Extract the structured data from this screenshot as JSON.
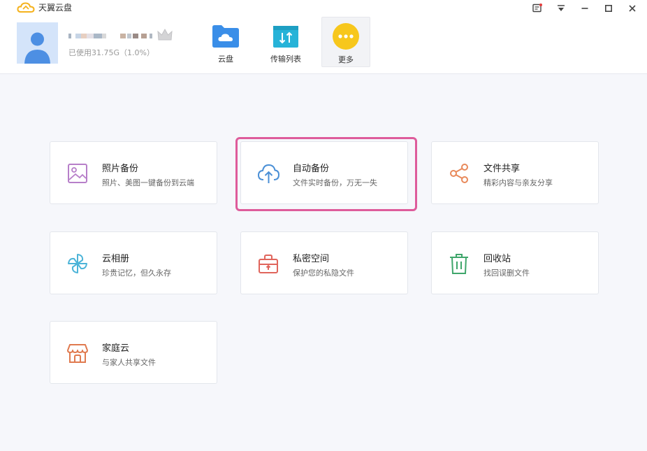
{
  "window": {
    "title": "天翼云盘",
    "controls": [
      "feedback-icon",
      "menu-dropdown-icon",
      "minimize-icon",
      "maximize-icon",
      "close-icon"
    ]
  },
  "user": {
    "storage_text": "已使用31.75G（1.0%）"
  },
  "nav": {
    "items": [
      {
        "label": "云盘",
        "icon": "folder-cloud-icon"
      },
      {
        "label": "传输列表",
        "icon": "transfer-icon"
      },
      {
        "label": "更多",
        "icon": "more-icon"
      }
    ],
    "active": "更多"
  },
  "cards": [
    {
      "title": "照片备份",
      "subtitle": "照片、美图一键备份到云端",
      "icon": "photo-icon",
      "color": "#b77fc9"
    },
    {
      "title": "自动备份",
      "subtitle": "文件实时备份，万无一失",
      "icon": "cloud-upload-icon",
      "color": "#4a8fd6"
    },
    {
      "title": "文件共享",
      "subtitle": "精彩内容与亲友分享",
      "icon": "share-icon",
      "color": "#e8895a"
    },
    {
      "title": "云相册",
      "subtitle": "珍贵记忆，但久永存",
      "icon": "pinwheel-icon",
      "color": "#4cb4d8"
    },
    {
      "title": "私密空间",
      "subtitle": "保护您的私隐文件",
      "icon": "safe-box-icon",
      "color": "#e0655c"
    },
    {
      "title": "回收站",
      "subtitle": "找回误删文件",
      "icon": "trash-icon",
      "color": "#3fa66b"
    },
    {
      "title": "家庭云",
      "subtitle": "与家人共享文件",
      "icon": "house-icon",
      "color": "#e07a4f"
    }
  ],
  "highlighted_card": "自动备份"
}
